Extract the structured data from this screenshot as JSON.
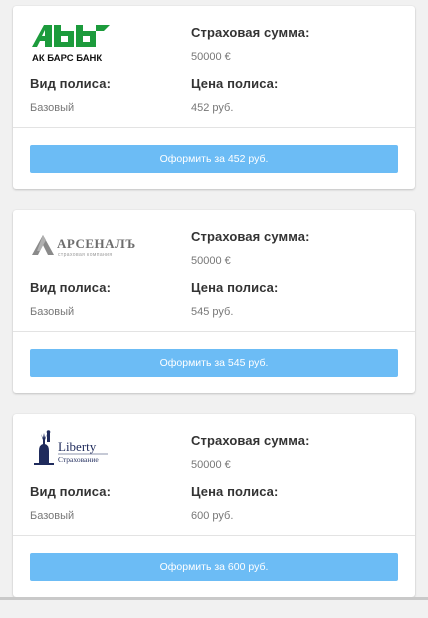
{
  "offers": [
    {
      "logo_icon": "ak-bars-bank-logo",
      "logo_text": "АК БАРС БАНК",
      "sum_label": "Страховая сумма:",
      "sum_value": "50000 €",
      "type_label": "Вид полиса:",
      "type_value": "Базовый",
      "price_label": "Цена полиса:",
      "price_value": "452 руб.",
      "button_label": "Оформить за 452 руб."
    },
    {
      "logo_icon": "arsenal-logo",
      "logo_text": "АРСЕНАЛЪ",
      "logo_subtext": "страховая компания",
      "sum_label": "Страховая сумма:",
      "sum_value": "50000 €",
      "type_label": "Вид полиса:",
      "type_value": "Базовый",
      "price_label": "Цена полиса:",
      "price_value": "545 руб.",
      "button_label": "Оформить за 545 руб."
    },
    {
      "logo_icon": "liberty-logo",
      "logo_text": "Liberty",
      "logo_subtext": "Страхование",
      "sum_label": "Страховая сумма:",
      "sum_value": "50000 €",
      "type_label": "Вид полиса:",
      "type_value": "Базовый",
      "price_label": "Цена полиса:",
      "price_value": "600 руб.",
      "button_label": "Оформить за 600 руб."
    }
  ],
  "colors": {
    "button": "#6cbcf5",
    "ak_bars_green": "#1c9b3c",
    "liberty_navy": "#1f2b5c"
  }
}
